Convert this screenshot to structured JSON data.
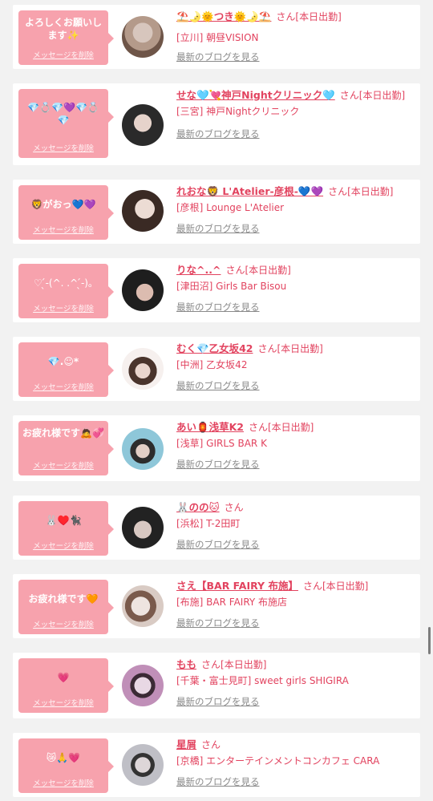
{
  "delete_label": "メッセージを削除",
  "blog_label": "最新のブログを見る",
  "cards": [
    {
      "message": "よろしくお願いします✨",
      "name": "⛱️🌛🌞つき🌞🌛⛱️",
      "san": "さん[本日出勤]",
      "shop": "[立川] 朝昼VISION",
      "avatar_colors": [
        "#b49a8a",
        "#6e5548"
      ]
    },
    {
      "message": "💎💍💎💜💎💍💎",
      "name": "せな🩵💘神戸Nightクリニック🩵",
      "san": "さん[本日出勤]",
      "shop": "[三宮] 神戸Nightクリニック",
      "avatar_colors": [
        "#2a2a2a",
        "#d9c7c0"
      ]
    },
    {
      "message": "🦁がおっ💙💜",
      "name": "れおな🦁 L'Atelier-彦根-💙💜",
      "san": "さん[本日出勤]",
      "shop": "[彦根] Lounge L'Atelier",
      "avatar_colors": [
        "#3a2a24",
        "#e8d6cc"
      ]
    },
    {
      "message": "♡ ̖́-(^. .^ ̖́-)｡",
      "name": "りな^..^",
      "san": "さん[本日出勤]",
      "shop": "[津田沼] Girls Bar Bisou",
      "avatar_colors": [
        "#1e1e1e",
        "#caa79b"
      ]
    },
    {
      "message": "💎.☺︎*",
      "name": "むく💎乙女坂42",
      "san": "さん[本日出勤]",
      "shop": "[中洲] 乙女坂42",
      "avatar_colors": [
        "#f6f0ee",
        "#4a342c"
      ]
    },
    {
      "message": "お疲れ様です🙇💞",
      "name": "あい🏮浅草K2",
      "san": "さん[本日出勤]",
      "shop": "[浅草] GIRLS BAR K",
      "avatar_colors": [
        "#8ec7d9",
        "#2d2d2d"
      ]
    },
    {
      "message": "🐰♥️🐈‍⬛",
      "name": "🐰のの🐱",
      "san": "さん",
      "shop": "[浜松] T-2田町",
      "avatar_colors": [
        "#222222",
        "#d8c8c2"
      ]
    },
    {
      "message": "お疲れ様です🧡",
      "name": "さえ【BAR FAIRY 布施】",
      "san": "さん[本日出勤]",
      "shop": "[布施] BAR FAIRY 布施店",
      "avatar_colors": [
        "#d9cbc4",
        "#7a5a4c"
      ]
    },
    {
      "message": "💗",
      "name": "もも",
      "san": "さん[本日出勤]",
      "shop": "[千葉・富士見町] sweet girls SHIGIRA",
      "avatar_colors": [
        "#c08fb8",
        "#3b2a35"
      ]
    },
    {
      "message": "😿🙏💗",
      "name": "星屑",
      "san": "さん",
      "shop": "[京橋] エンターテインメントコンカフェ CARA",
      "avatar_colors": [
        "#bfbfc6",
        "#333333"
      ]
    }
  ]
}
